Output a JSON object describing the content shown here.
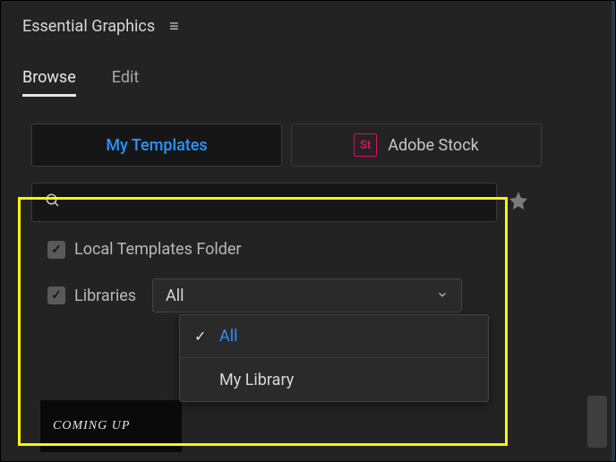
{
  "panel": {
    "title": "Essential Graphics"
  },
  "tabs": [
    {
      "label": "Browse",
      "active": true
    },
    {
      "label": "Edit",
      "active": false
    }
  ],
  "sources": [
    {
      "label": "My Templates",
      "active": true
    },
    {
      "label": "Adobe Stock",
      "active": false,
      "iconText": "St"
    }
  ],
  "search": {
    "value": "",
    "placeholder": ""
  },
  "options": {
    "localTemplates": {
      "label": "Local Templates Folder",
      "checked": true
    },
    "libraries": {
      "label": "Libraries",
      "checked": true
    }
  },
  "librariesDropdown": {
    "selected": "All",
    "open": true,
    "items": [
      {
        "label": "All",
        "selected": true
      },
      {
        "label": "My Library",
        "selected": false
      }
    ]
  },
  "templatePreview": {
    "text": "COMING UP"
  }
}
